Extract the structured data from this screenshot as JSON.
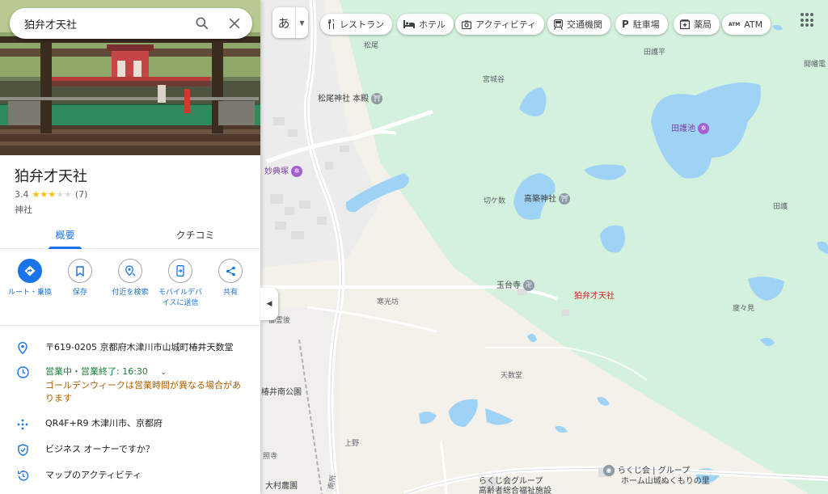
{
  "search": {
    "value": "狛弁才天社"
  },
  "ime": {
    "char": "あ"
  },
  "chips": [
    {
      "label": "レストラン",
      "icon": "restaurant-icon"
    },
    {
      "label": "ホテル",
      "icon": "hotel-icon"
    },
    {
      "label": "アクティビティ",
      "icon": "camera-icon"
    },
    {
      "label": "交通機関",
      "icon": "train-icon"
    },
    {
      "label": "駐車場",
      "icon": "parking-icon"
    },
    {
      "label": "薬局",
      "icon": "pharmacy-icon"
    },
    {
      "label": "ATM",
      "icon": "atm-icon",
      "icon_text": "ATM"
    }
  ],
  "place": {
    "title": "狛弁才天社",
    "rating": "3.4",
    "rating_stars": 3.4,
    "review_count": "(7)",
    "category": "神社"
  },
  "tabs": [
    {
      "label": "概要",
      "active": true
    },
    {
      "label": "クチコミ",
      "active": false
    }
  ],
  "actions": [
    {
      "label": "ルート・乗換",
      "icon": "directions-icon"
    },
    {
      "label": "保存",
      "icon": "bookmark-icon"
    },
    {
      "label": "付近を検索",
      "icon": "nearby-icon"
    },
    {
      "label": "モバイルデバイスに送信",
      "icon": "send-to-phone-icon"
    },
    {
      "label": "共有",
      "icon": "share-icon"
    }
  ],
  "info": {
    "address": "〒619-0205 京都府木津川市山城町椿井天数堂",
    "hours_status": "営業中・営業終了: 16:30",
    "hours_note": "ゴールデンウィークは営業時間が異なる場合があります",
    "plus_code": "QR4F+R9 木津川市、京都府",
    "business_owner": "ビジネス オーナーですか？",
    "activity": "マップのアクティビティ"
  },
  "map": {
    "pin_label": "狛弁才天社",
    "labels": {
      "matsuo": "松尾",
      "miyashirodani": "宮城谷",
      "tagohira": "田護平",
      "kaikotai": "開幡電",
      "matsuo_shrine": "松尾神社 本殿",
      "tagoike": "田護池",
      "myotenzuka": "妙典塚",
      "kirikazu": "切ケ数",
      "takasuki_shrine": "高築神社",
      "tago": "田護",
      "gyokudaiji": "玉台寺",
      "kankobo": "寒光坊",
      "dodomi": "度々見",
      "gohorigo": "御霊後",
      "tensudo": "天数堂",
      "tsubaii_park": "椿井南公園",
      "ueno": "上野",
      "shoji": "照寺",
      "omura": "大村農園",
      "rakujikai1": "らくじ会グループ",
      "rakujikai2": "高齢者総合福祉施設",
      "rakuji_home1": "らくじ会 | グループ",
      "rakuji_home2": "ホーム山城ぬくもりの里",
      "nansho": "南所"
    }
  },
  "colors": {
    "accent": "#1a73e8",
    "forest": "#cdeed9",
    "water": "#9fd3f5",
    "land": "#f4f1ea",
    "pin": "#ea4335",
    "open": "#188038",
    "warning": "#b06000"
  }
}
